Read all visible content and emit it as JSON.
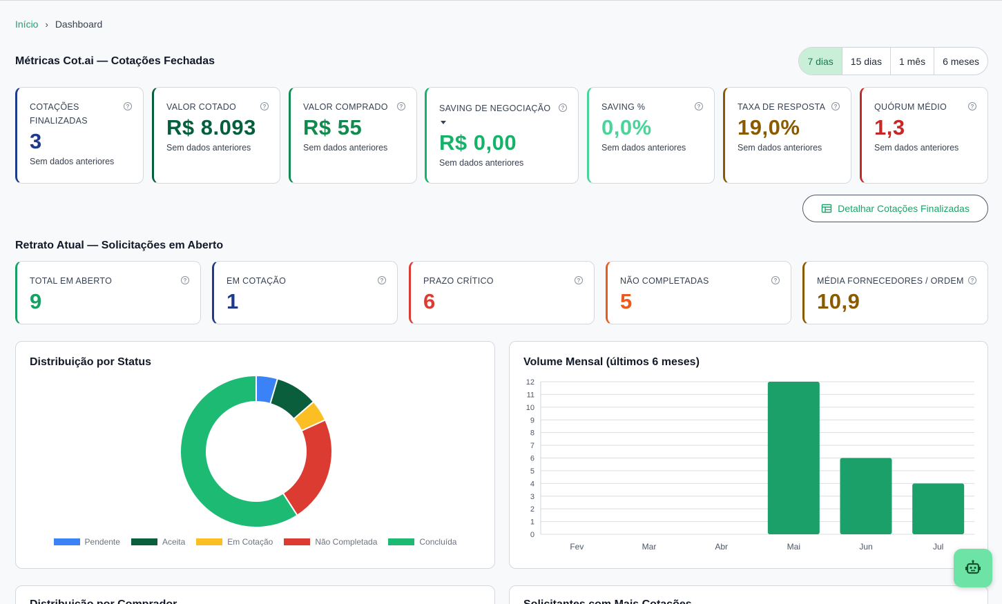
{
  "breadcrumb": {
    "home": "Início",
    "separator": "›",
    "current": "Dashboard"
  },
  "closed_section": {
    "title": "Métricas Cot.ai — Cotações Fechadas",
    "ranges": [
      "7 dias",
      "15 dias",
      "1 mês",
      "6 meses"
    ],
    "active_range": "7 dias",
    "cards": [
      {
        "label": "Cotações Finalizadas",
        "value": "3",
        "sub": "Sem dados anteriores",
        "color": "#1e3a8a"
      },
      {
        "label": "Valor Cotado",
        "value": "R$ 8.093",
        "sub": "Sem dados anteriores",
        "color": "#065f3c"
      },
      {
        "label": "Valor Comprado",
        "value": "R$ 55",
        "sub": "Sem dados anteriores",
        "color": "#12894f"
      },
      {
        "label": "Saving de Negociação",
        "value": "R$ 0,00",
        "sub": "Sem dados anteriores",
        "color": "#17b26a"
      },
      {
        "label": "Saving %",
        "value": "0,0%",
        "sub": "Sem dados anteriores",
        "color": "#4cd39a"
      },
      {
        "label": "Taxa de Resposta",
        "value": "19,0%",
        "sub": "Sem dados anteriores",
        "color": "#8a5a00"
      },
      {
        "label": "Quórum Médio",
        "value": "1,3",
        "sub": "Sem dados anteriores",
        "color": "#c62828"
      }
    ],
    "detail_button": "Detalhar Cotações Finalizadas"
  },
  "open_section": {
    "title": "Retrato Atual — Solicitações em Aberto",
    "cards": [
      {
        "label": "Total em Aberto",
        "value": "9",
        "color": "#17a062"
      },
      {
        "label": "Em Cotação",
        "value": "1",
        "color": "#1e3a8a"
      },
      {
        "label": "Prazo Crítico",
        "value": "6",
        "color": "#dc3b32"
      },
      {
        "label": "Não Completadas",
        "value": "5",
        "color": "#ea5a1c"
      },
      {
        "label": "Média Fornecedores / Ordem",
        "value": "10,9",
        "color": "#8a5a00"
      }
    ]
  },
  "status_panel": {
    "title": "Distribuição por Status"
  },
  "volume_panel": {
    "title": "Volume Mensal (últimos 6 meses)"
  },
  "bottom_panels": {
    "left_title": "Distribuição por Comprador",
    "right_title": "Solicitantes com Mais Cotações"
  },
  "bot_icon": "robot-icon",
  "chart_data": [
    {
      "type": "pie",
      "donut": true,
      "categories": [
        "Pendente",
        "Aceita",
        "Em Cotação",
        "Não Completada",
        "Concluída"
      ],
      "values": [
        1,
        2,
        1,
        5,
        13
      ],
      "colors": [
        "#3b82f6",
        "#0b5e3b",
        "#fbbf24",
        "#dc3b32",
        "#1dba73"
      ],
      "legend": "bottom"
    },
    {
      "type": "bar",
      "categories": [
        "Fev",
        "Mar",
        "Abr",
        "Mai",
        "Jun",
        "Jul"
      ],
      "values": [
        0,
        0,
        0,
        12,
        6,
        4
      ],
      "ylim": [
        0,
        12
      ],
      "yticks": [
        0,
        1,
        2,
        3,
        4,
        5,
        6,
        7,
        8,
        9,
        10,
        11,
        12
      ],
      "grid": true,
      "color": "#1aa068"
    }
  ]
}
